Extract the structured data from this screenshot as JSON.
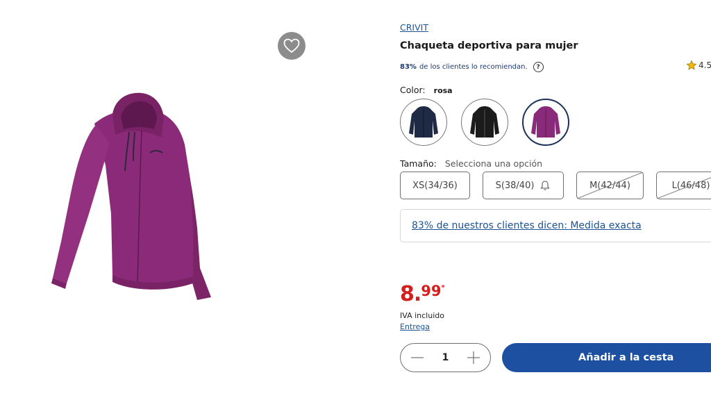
{
  "product": {
    "brand": "CRIVIT",
    "title": "Chaqueta deportiva para mujer",
    "recommend_pct": "83%",
    "recommend_text": "de los clientes lo recomiendan.",
    "help_symbol": "?",
    "rating": "4.5"
  },
  "color": {
    "label": "Color:",
    "selected": "rosa",
    "swatches": [
      {
        "name": "navy",
        "hex": "#1f2a44"
      },
      {
        "name": "black",
        "hex": "#1b1b1b"
      },
      {
        "name": "rosa",
        "hex": "#8a2a7a",
        "selected": true
      }
    ]
  },
  "size": {
    "label": "Tamaño:",
    "hint": "Selecciona una opción",
    "options": [
      {
        "label": "XS(34/36)",
        "available": true
      },
      {
        "label": "S(38/40)",
        "available": true,
        "notify_icon": "bell-icon"
      },
      {
        "label": "M(42/44)",
        "available": false
      },
      {
        "label": "L(46/48)",
        "available": false
      }
    ]
  },
  "fit_text": "83% de nuestros clientes dicen: Medida exacta",
  "price": {
    "integer": "8.",
    "cents": "99",
    "asterisk": "*",
    "vat": "IVA incluido",
    "delivery": "Entrega",
    "color": "#d41f1f"
  },
  "cart": {
    "quantity": "1",
    "add_label": "Añadir a la cesta",
    "button_color": "#1d50a0"
  },
  "icons": {
    "favorite": "heart-icon",
    "rating": "star-icon",
    "minus": "minus-icon",
    "plus": "plus-icon"
  }
}
